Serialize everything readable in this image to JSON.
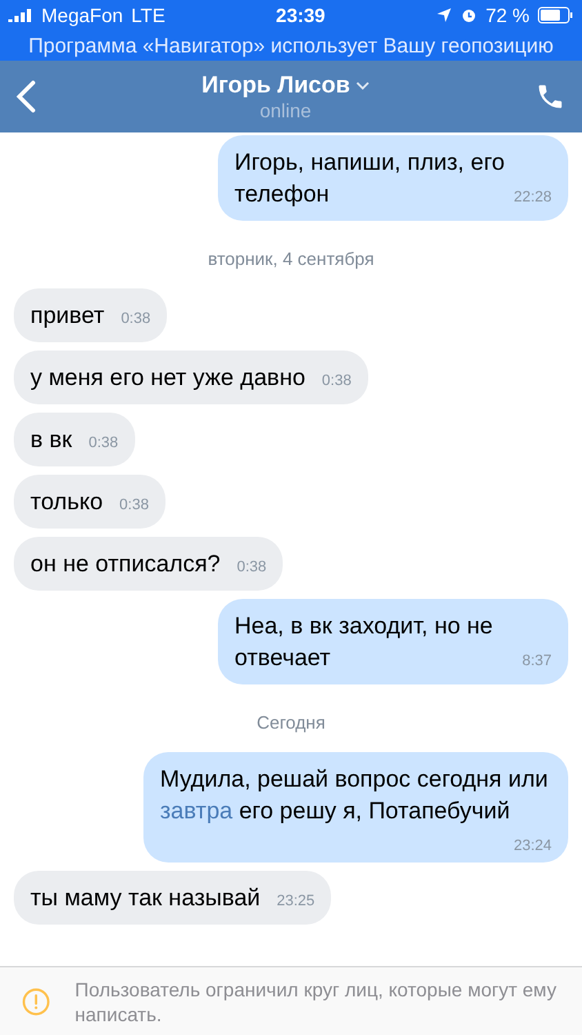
{
  "status_bar": {
    "carrier": "MegaFon",
    "network": "LTE",
    "time": "23:39",
    "battery": "72 %"
  },
  "location_banner": "Программа «Навигатор» использует Вашу геопозицию",
  "header": {
    "name": "Игорь Лисов",
    "status": "online"
  },
  "feed": [
    {
      "kind": "message",
      "outgoing": true,
      "parts": [
        {
          "kind": "text",
          "text": "Игорь, напиши, плиз, его телефон"
        }
      ],
      "time": "22:28"
    },
    {
      "kind": "date",
      "text": "вторник, 4 сентября"
    },
    {
      "kind": "message",
      "outgoing": false,
      "parts": [
        {
          "kind": "text",
          "text": "привет"
        }
      ],
      "time": "0:38"
    },
    {
      "kind": "message",
      "outgoing": false,
      "parts": [
        {
          "kind": "text",
          "text": "у меня его нет уже давно"
        }
      ],
      "time": "0:38"
    },
    {
      "kind": "message",
      "outgoing": false,
      "parts": [
        {
          "kind": "text",
          "text": "в вк"
        }
      ],
      "time": "0:38"
    },
    {
      "kind": "message",
      "outgoing": false,
      "parts": [
        {
          "kind": "text",
          "text": "только"
        }
      ],
      "time": "0:38"
    },
    {
      "kind": "message",
      "outgoing": false,
      "parts": [
        {
          "kind": "text",
          "text": "он не отписался?"
        }
      ],
      "time": "0:38"
    },
    {
      "kind": "message",
      "outgoing": true,
      "parts": [
        {
          "kind": "text",
          "text": "Неа, в вк заходит, но не отвечает"
        }
      ],
      "time": "8:37"
    },
    {
      "kind": "date",
      "text": "Сегодня"
    },
    {
      "kind": "message",
      "outgoing": true,
      "parts": [
        {
          "kind": "text",
          "text": "Мудила, решай вопрос сегодня или "
        },
        {
          "kind": "link",
          "text": "завтра"
        },
        {
          "kind": "text",
          "text": " его решу я, Потапебучий"
        }
      ],
      "time": "23:24"
    },
    {
      "kind": "message",
      "outgoing": false,
      "parts": [
        {
          "kind": "text",
          "text": "ты маму так называй"
        }
      ],
      "time": "23:25"
    }
  ],
  "notice": "Пользователь ограничил круг лиц, которые могут ему написать."
}
